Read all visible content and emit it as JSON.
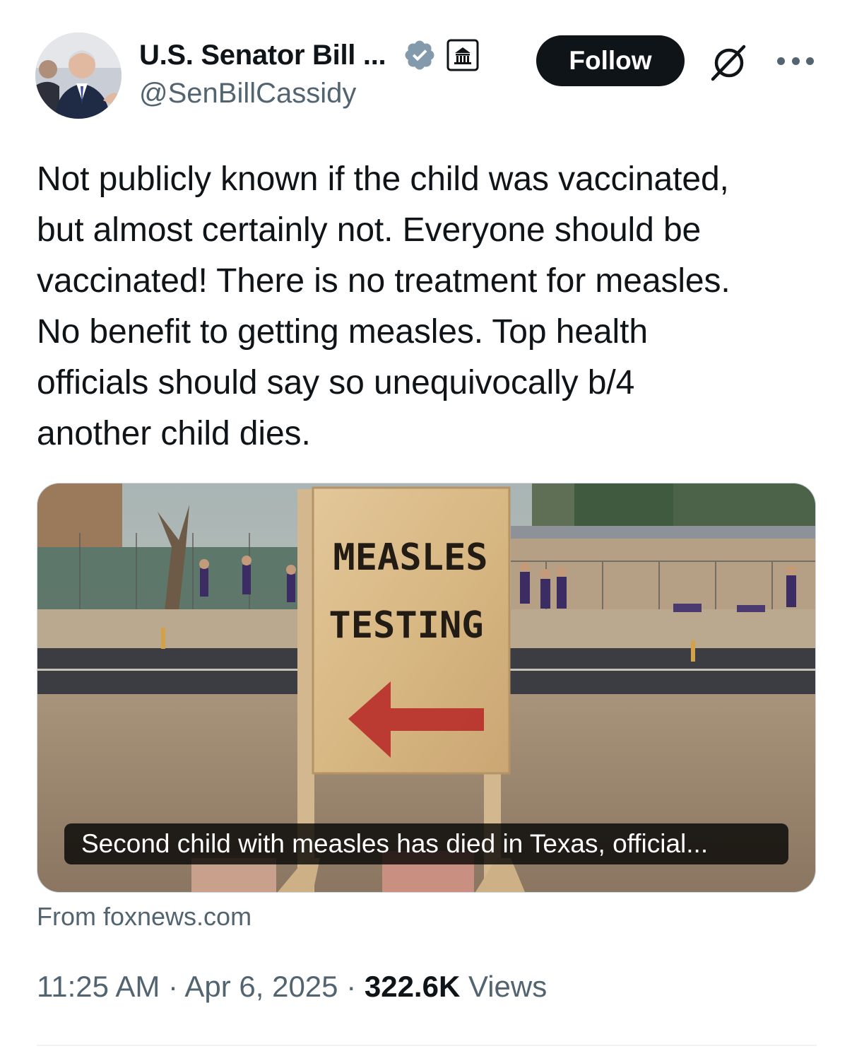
{
  "author": {
    "display_name": "U.S. Senator Bill ...",
    "handle": "@SenBillCassidy"
  },
  "actions": {
    "follow_label": "Follow"
  },
  "icons": {
    "verified": "verified-badge-icon",
    "government": "government-building-icon",
    "grok": "grok-icon",
    "more": "more-options-icon"
  },
  "colors": {
    "verified_badge": "#829aab",
    "follow_button_bg": "#0f1419",
    "secondary_text": "#536471"
  },
  "tweet": {
    "lines": [
      "Not publicly known if the child was vaccinated,",
      "but almost certainly not. Everyone should be",
      "vaccinated! There is no treatment for measles.",
      "No benefit to getting measles. Top health",
      "officials should say so unequivocally b/4",
      "another child dies."
    ]
  },
  "link_card": {
    "caption": "Second child with measles has died in Texas, official...",
    "sign_line1": "MEASLES",
    "sign_line2": "TESTING",
    "source": "From foxnews.com"
  },
  "meta": {
    "time": "11:25 AM",
    "date": "Apr 6, 2025",
    "views_count": "322.6K",
    "views_label": "Views"
  }
}
